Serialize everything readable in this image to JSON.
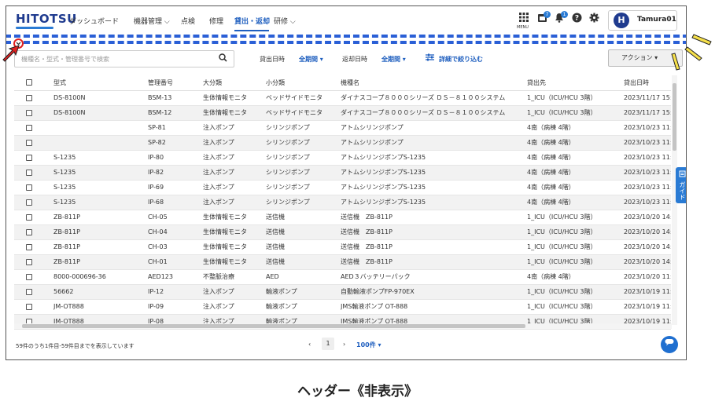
{
  "header": {
    "logo": "HITOTSU",
    "nav": [
      {
        "label": "ダッシュボード"
      },
      {
        "label": "機器管理 ⌵"
      },
      {
        "label": "点検"
      },
      {
        "label": "修理"
      },
      {
        "label": "貸出・返却"
      },
      {
        "label": "研修 ⌵"
      }
    ],
    "menu_label": "MENU",
    "badges": {
      "b1": "7",
      "b2": "1"
    },
    "user": {
      "initial": "H",
      "name": "Tamura01"
    }
  },
  "toolbar": {
    "search_placeholder": "機種名・型式・管理番号で検索",
    "lend_date_label": "貸出日時",
    "lend_date_value": "全期間 ▾",
    "return_date_label": "返却日時",
    "return_date_value": "全期間 ▾",
    "detail_filter": "詳細で絞り込む",
    "action_button": "アクション ▾"
  },
  "table": {
    "columns": [
      "型式",
      "管理番号",
      "大分類",
      "小分類",
      "機種名",
      "貸出先",
      "貸出日時"
    ],
    "rows": [
      [
        "DS-8100N",
        "BSM-13",
        "生体情報モニタ",
        "ベッドサイドモニタ",
        "ダイナスコープ８０００シリーズ ＤＳ－８１００システム",
        "1_ICU（ICU/HCU 3階）",
        "2023/11/17 15:"
      ],
      [
        "DS-8100N",
        "BSM-12",
        "生体情報モニタ",
        "ベッドサイドモニタ",
        "ダイナスコープ８０００シリーズ ＤＳ－８１００システム",
        "1_ICU（ICU/HCU 3階）",
        "2023/11/17 15:"
      ],
      [
        "",
        "SP-81",
        "注入ポンプ",
        "シリンジポンプ",
        "アトムシリンジポンプ",
        "4南（病棟 4階）",
        "2023/10/23 11:"
      ],
      [
        "",
        "SP-82",
        "注入ポンプ",
        "シリンジポンプ",
        "アトムシリンジポンプ",
        "4南（病棟 4階）",
        "2023/10/23 11:"
      ],
      [
        "S-1235",
        "IP-80",
        "注入ポンプ",
        "シリンジポンプ",
        "アトムシリンジポンプS-1235",
        "4南（病棟 4階）",
        "2023/10/23 11:"
      ],
      [
        "S-1235",
        "IP-82",
        "注入ポンプ",
        "シリンジポンプ",
        "アトムシリンジポンプS-1235",
        "4南（病棟 4階）",
        "2023/10/23 11:"
      ],
      [
        "S-1235",
        "IP-69",
        "注入ポンプ",
        "シリンジポンプ",
        "アトムシリンジポンプS-1235",
        "4南（病棟 4階）",
        "2023/10/23 11:"
      ],
      [
        "S-1235",
        "IP-68",
        "注入ポンプ",
        "シリンジポンプ",
        "アトムシリンジポンプS-1235",
        "4南（病棟 4階）",
        "2023/10/23 11:"
      ],
      [
        "ZB-811P",
        "CH-05",
        "生体情報モニタ",
        "送信機",
        "送信機　ZB-811P",
        "1_ICU（ICU/HCU 3階）",
        "2023/10/20 14:"
      ],
      [
        "ZB-811P",
        "CH-04",
        "生体情報モニタ",
        "送信機",
        "送信機　ZB-811P",
        "1_ICU（ICU/HCU 3階）",
        "2023/10/20 14:"
      ],
      [
        "ZB-811P",
        "CH-03",
        "生体情報モニタ",
        "送信機",
        "送信機　ZB-811P",
        "1_ICU（ICU/HCU 3階）",
        "2023/10/20 14:"
      ],
      [
        "ZB-811P",
        "CH-01",
        "生体情報モニタ",
        "送信機",
        "送信機　ZB-811P",
        "1_ICU（ICU/HCU 3階）",
        "2023/10/20 14:"
      ],
      [
        "8000-000696-36",
        "AED123",
        "不整脈治療",
        "AED",
        "AED３バッテリーパック",
        "4南（病棟 4階）",
        "2023/10/20 11:"
      ],
      [
        "56662",
        "IP-12",
        "注入ポンプ",
        "輸液ポンプ",
        "自動輸液ポンプFP-970EX",
        "1_ICU（ICU/HCU 3階）",
        "2023/10/19 11:"
      ],
      [
        "JM-OT888",
        "IP-09",
        "注入ポンプ",
        "輸液ポンプ",
        "JMS輸液ポンプ OT-888",
        "1_ICU（ICU/HCU 3階）",
        "2023/10/19 11:"
      ],
      [
        "JM-OT888",
        "IP-08",
        "注入ポンプ",
        "輸液ポンプ",
        "JMS輸液ポンプ OT-888",
        "1_ICU（ICU/HCU 3階）",
        "2023/10/19 11:"
      ]
    ]
  },
  "guide_label": "ガイド",
  "footer": {
    "summary": "59件のうち1件目-59件目までを表示しています",
    "page": "1",
    "per_page": "100件 ▾"
  },
  "caption": "ヘッダー《非表示》",
  "colors": {
    "accent": "#1f5fbf",
    "dashed_outline": "#2a5fd6",
    "highlight": "#e02020"
  }
}
